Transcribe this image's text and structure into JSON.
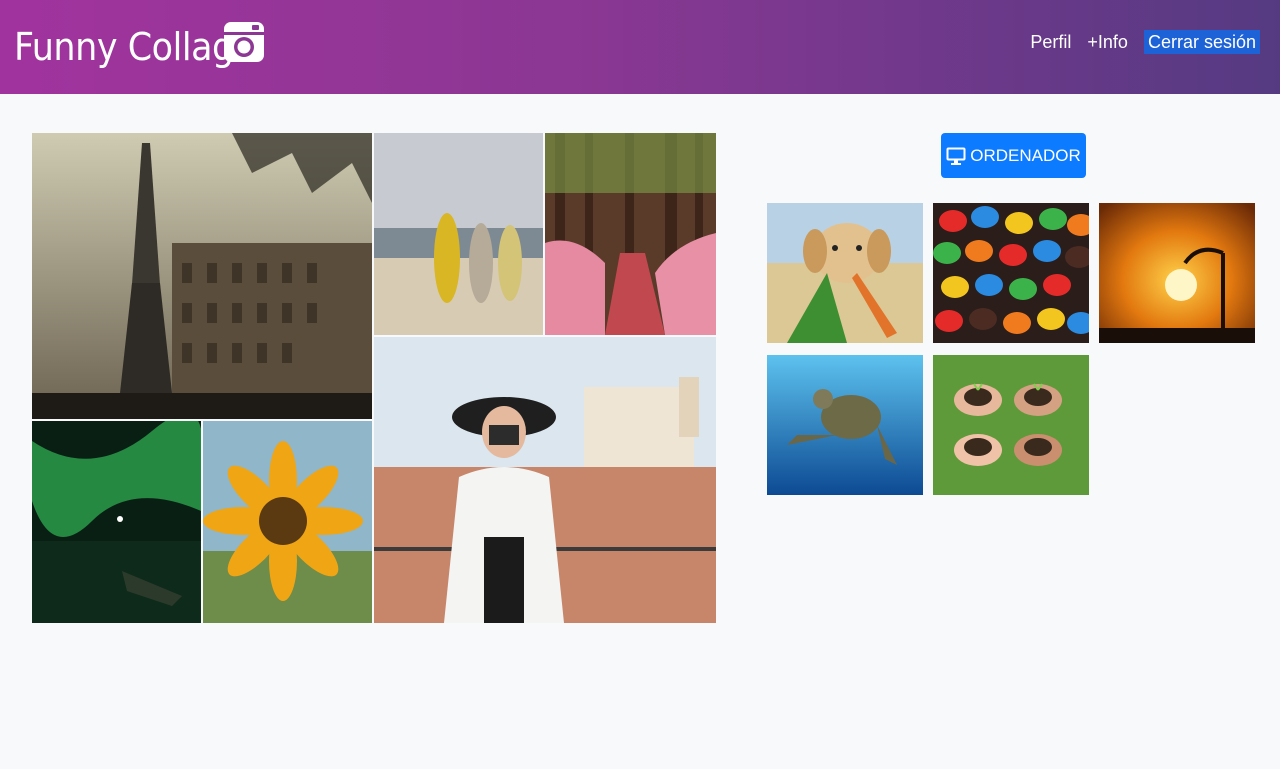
{
  "header": {
    "brand": "Funny Collage",
    "brand_icon": "camera-icon",
    "nav": [
      {
        "label": "Perfil"
      },
      {
        "label": "+Info"
      },
      {
        "label": "Cerrar sesión",
        "active": true
      }
    ],
    "gradient_start": "#a1339e",
    "gradient_end": "#553a82"
  },
  "collage": {
    "tiles": [
      {
        "subject": "eiffel-tower-paris"
      },
      {
        "subject": "surfboards-beach"
      },
      {
        "subject": "forest-path-flowers"
      },
      {
        "subject": "woman-with-camera"
      },
      {
        "subject": "aurora-lake-night"
      },
      {
        "subject": "sunflower"
      }
    ]
  },
  "sidebar": {
    "sort_button": {
      "label": "ORDENADOR",
      "icon": "monitor-icon",
      "color": "#0d7bff"
    },
    "thumbnails": [
      {
        "subject": "dog-with-carrots"
      },
      {
        "subject": "colorful-candies"
      },
      {
        "subject": "sunset-streetlamp"
      },
      {
        "subject": "sea-turtle"
      },
      {
        "subject": "hands-holding-soil-plants"
      }
    ]
  }
}
